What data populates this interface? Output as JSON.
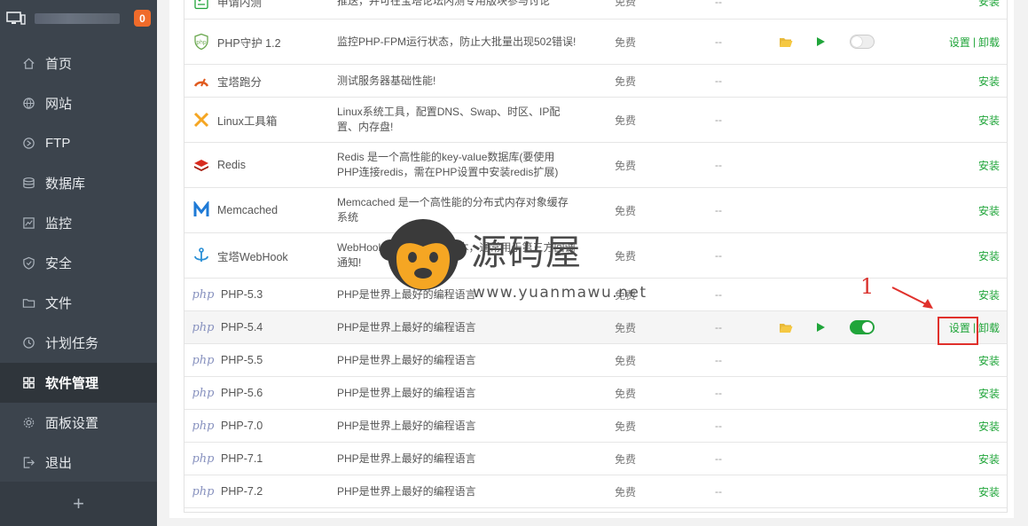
{
  "sidebar": {
    "badge": "0",
    "items": [
      {
        "label": "首页",
        "icon": "home-icon"
      },
      {
        "label": "网站",
        "icon": "globe-icon"
      },
      {
        "label": "FTP",
        "icon": "ftp-icon"
      },
      {
        "label": "数据库",
        "icon": "database-icon"
      },
      {
        "label": "监控",
        "icon": "monitor-chart-icon"
      },
      {
        "label": "安全",
        "icon": "shield-icon"
      },
      {
        "label": "文件",
        "icon": "folder-icon"
      },
      {
        "label": "计划任务",
        "icon": "clock-icon"
      },
      {
        "label": "软件管理",
        "icon": "apps-grid-icon"
      },
      {
        "label": "面板设置",
        "icon": "gear-icon"
      },
      {
        "label": "退出",
        "icon": "logout-icon"
      }
    ],
    "add_label": "+"
  },
  "software": {
    "rows": [
      {
        "name": "申请内测",
        "desc": "推送，并可在宝塔论坛内测专用版块参与讨论",
        "price": "免费",
        "expire": "--",
        "ops": [
          "安装"
        ]
      },
      {
        "name": "PHP守护 1.2",
        "desc": "监控PHP-FPM运行状态，防止大批量出现502错误!",
        "price": "免费",
        "expire": "--",
        "ops": [
          "设置",
          "卸载"
        ]
      },
      {
        "name": "宝塔跑分",
        "desc": "测试服务器基础性能!",
        "price": "免费",
        "expire": "--",
        "ops": [
          "安装"
        ]
      },
      {
        "name": "Linux工具箱",
        "desc": "Linux系统工具，配置DNS、Swap、时区、IP配置、内存盘!",
        "price": "免费",
        "expire": "--",
        "ops": [
          "安装"
        ]
      },
      {
        "name": "Redis",
        "desc": "Redis 是一个高性能的key-value数据库(要使用PHP连接redis，需在PHP设置中安装redis扩展)",
        "price": "免费",
        "expire": "--",
        "ops": [
          "安装"
        ]
      },
      {
        "name": "Memcached",
        "desc": "Memcached 是一个高性能的分布式内存对象缓存系统",
        "price": "免费",
        "expire": "--",
        "ops": [
          "安装"
        ]
      },
      {
        "name": "宝塔WebHook",
        "desc": "WebHook，可设置回调脚本，通常用于第三方回调通知!",
        "price": "免费",
        "expire": "--",
        "ops": [
          "安装"
        ]
      },
      {
        "name": "PHP-5.3",
        "desc": "PHP是世界上最好的编程语言",
        "price": "免费",
        "expire": "--",
        "ops": [
          "安装"
        ]
      },
      {
        "name": "PHP-5.4",
        "desc": "PHP是世界上最好的编程语言",
        "price": "免费",
        "expire": "--",
        "ops": [
          "设置",
          "卸载"
        ]
      },
      {
        "name": "PHP-5.5",
        "desc": "PHP是世界上最好的编程语言",
        "price": "免费",
        "expire": "--",
        "ops": [
          "安装"
        ]
      },
      {
        "name": "PHP-5.6",
        "desc": "PHP是世界上最好的编程语言",
        "price": "免费",
        "expire": "--",
        "ops": [
          "安装"
        ]
      },
      {
        "name": "PHP-7.0",
        "desc": "PHP是世界上最好的编程语言",
        "price": "免费",
        "expire": "--",
        "ops": [
          "安装"
        ]
      },
      {
        "name": "PHP-7.1",
        "desc": "PHP是世界上最好的编程语言",
        "price": "免费",
        "expire": "--",
        "ops": [
          "安装"
        ]
      },
      {
        "name": "PHP-7.2",
        "desc": "PHP是世界上最好的编程语言",
        "price": "免费",
        "expire": "--",
        "ops": [
          "安装"
        ]
      }
    ],
    "php_icon_text": "php"
  },
  "watermark": {
    "text": "源码屋",
    "url": "www.yuanmawu.net"
  },
  "annotation": {
    "number": "1"
  },
  "colors": {
    "sidebar_bg": "#3c444d",
    "accent_green": "#20a53a",
    "badge_orange": "#f06b2a",
    "annotation_red": "#e0302b"
  }
}
